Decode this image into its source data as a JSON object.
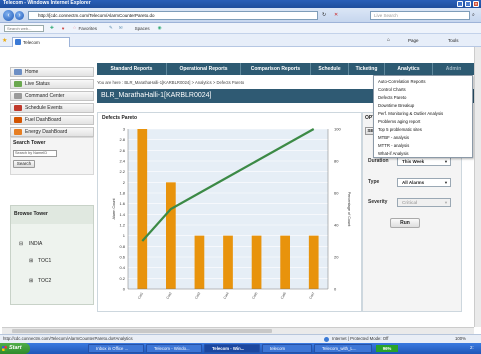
{
  "window": {
    "title": "Telecom - Windows Internet Explorer"
  },
  "address_bar": {
    "url": "http://[cdc.connectm.com/Telecom/AlarmCounterPareto.do",
    "search_placeholder": "Live Search"
  },
  "toolbar": {
    "search_web": "Search web...",
    "favorites": "Favorites",
    "spaces": "Spaces"
  },
  "browser_tab": {
    "label": "Telecom"
  },
  "ie_commands": {
    "page": "Page",
    "tools": "Tools"
  },
  "sidebar": {
    "items": [
      {
        "label": "Home",
        "icon": "home-icon"
      },
      {
        "label": "Live Status",
        "icon": "live-status-icon"
      },
      {
        "label": "Command Center",
        "icon": "command-center-icon"
      },
      {
        "label": "Schedule Events",
        "icon": "schedule-icon"
      },
      {
        "label": "Fuel DashBoard",
        "icon": "fuel-icon"
      },
      {
        "label": "Energy DashBoard",
        "icon": "energy-icon"
      }
    ],
    "search_tower": {
      "heading": "Search Tower",
      "placeholder": "Search by NameID",
      "button": "Search"
    },
    "browse_tower": {
      "heading": "Browse Tower",
      "tree": [
        {
          "label": "INDIA"
        },
        {
          "label": "TOC1"
        },
        {
          "label": "TOC2"
        }
      ]
    }
  },
  "main_nav": {
    "items": [
      "Standard Reports",
      "Operational Reports",
      "Comparison Reports",
      "Schedule",
      "Ticketing",
      "Analytics",
      "Admin"
    ]
  },
  "breadcrumb": {
    "text": "You are here : BLR_MarathaHalli-1[KARBLR0024] > Analytics > Defects Pareto"
  },
  "page_title": "BLR_MarathaHalli-1[KARBLR0024]",
  "chart_panel": {
    "title": "Defects Pareto"
  },
  "chart_data": {
    "type": "bar",
    "title": "Defects Pareto",
    "ylabel": "Alarm Count",
    "y2label": "Percentage of Count",
    "categories": [
      "Cat1",
      "Cat2",
      "Cat3",
      "Cat4",
      "Cat5",
      "Cat6",
      "Cat7"
    ],
    "values": [
      3,
      2,
      1,
      1,
      1,
      1,
      1
    ],
    "ylim": [
      0,
      3
    ],
    "yticks": [
      "0",
      "0.2",
      "0.4",
      "0.6",
      "0.8",
      "1",
      "1.2",
      "1.4",
      "1.6",
      "1.8",
      "2",
      "2.2",
      "2.4",
      "2.6",
      "2.8",
      "3"
    ],
    "cumulative_percent": [
      30,
      50,
      60,
      70,
      80,
      90,
      100
    ],
    "y2ticks": [
      "0",
      "20",
      "40",
      "60",
      "80",
      "100"
    ],
    "y2lim": [
      0,
      100
    ],
    "colors": {
      "bar": "#e8930c",
      "line": "#3c8a46"
    }
  },
  "options": {
    "header": "OPTI",
    "sea_button": "SEA",
    "duration": {
      "label": "Duration",
      "value": "This Week"
    },
    "type": {
      "label": "Type",
      "value": "All Alarms"
    },
    "severity": {
      "label": "Severity",
      "value": "Critical"
    },
    "run_button": "Run"
  },
  "analytics_menu": {
    "items": [
      "Auto-Correlation Reports",
      "Control Charts",
      "Defects Pareto",
      "Downtime Breakup",
      "Perf. Monitoring & Outlier Analysis",
      "Problems aging report",
      "Top 5 problematic sites",
      "MTBF - analysis",
      "MTTR - analysis",
      "What-if Analysis"
    ]
  },
  "status_bar": {
    "url": "http://cdc.connectm.com/Telecom/AlarmCounterPareto.do#Analytics",
    "zone": "Internet | Protected Mode: Off",
    "zoom": "100%"
  },
  "taskbar": {
    "start": "Start",
    "tasks": [
      "Inbox in Office ...",
      "Telecom - Windo...",
      "Telecom - Win...",
      "telecom",
      "Telecom_with_L..."
    ],
    "tray": "96%",
    "clock": "2:"
  },
  "colors": {
    "nav_bg": "#2d5a72",
    "accent_orange": "#e8930c",
    "line_green": "#3c8a46"
  }
}
